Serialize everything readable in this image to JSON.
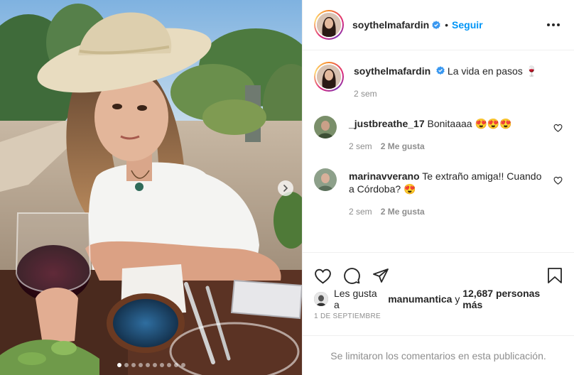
{
  "header": {
    "username": "soythelmafardin",
    "separator": "•",
    "follow_label": "Seguir"
  },
  "caption": {
    "username": "soythelmafardin",
    "text": "La vida en pasos 🍷",
    "time": "2 sem"
  },
  "comments": [
    {
      "username": "_justbreathe_17",
      "text": "Bonitaaaa 😍😍😍",
      "time": "2 sem",
      "likes": "2 Me gusta"
    },
    {
      "username": "marinavverano",
      "text": "Te extraño amiga!! Cuando a Córdoba? 😍",
      "time": "2 sem",
      "likes": "2 Me gusta"
    }
  ],
  "likes": {
    "prefix": "Les gusta a",
    "user": "manumantica",
    "connector": "y",
    "others": "12,687 personas más"
  },
  "date": "1 DE SEPTIEMBRE",
  "comments_limited": "Se limitaron los comentarios en esta publicación.",
  "carousel": {
    "count": 10,
    "active_index": 0
  },
  "colors": {
    "accent": "#0095f6",
    "verified": "#3897f0",
    "muted": "#8e8e8e"
  },
  "icons": [
    "verified-badge-icon",
    "more-options-icon",
    "heart-icon",
    "comment-icon",
    "share-icon",
    "bookmark-icon",
    "chevron-right-icon"
  ]
}
